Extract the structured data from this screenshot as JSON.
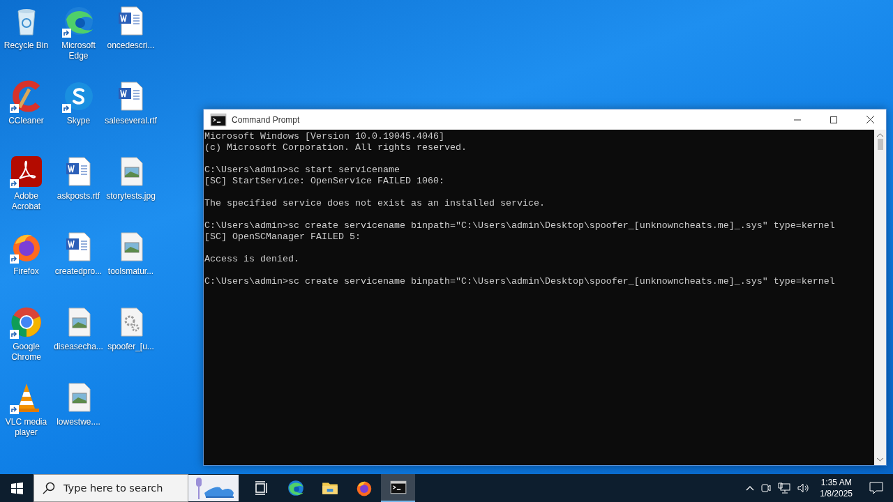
{
  "desktop_icons": [
    {
      "label": "Recycle Bin",
      "kind": "recycle",
      "shortcut": false
    },
    {
      "label": "CCleaner",
      "kind": "ccleaner",
      "shortcut": true
    },
    {
      "label": "Adobe Acrobat",
      "kind": "acrobat",
      "shortcut": true
    },
    {
      "label": "Firefox",
      "kind": "firefox",
      "shortcut": true
    },
    {
      "label": "Google Chrome",
      "kind": "chrome",
      "shortcut": true
    },
    {
      "label": "VLC media player",
      "kind": "vlc",
      "shortcut": true
    },
    {
      "label": "Microsoft Edge",
      "kind": "edge",
      "shortcut": true
    },
    {
      "label": "Skype",
      "kind": "skype",
      "shortcut": true
    },
    {
      "label": "askposts.rtf",
      "kind": "word",
      "shortcut": false
    },
    {
      "label": "createdpro...",
      "kind": "word",
      "shortcut": false
    },
    {
      "label": "diseasecha...",
      "kind": "image",
      "shortcut": false
    },
    {
      "label": "lowestwe....",
      "kind": "image",
      "shortcut": false
    },
    {
      "label": "oncedescri...",
      "kind": "word",
      "shortcut": false
    },
    {
      "label": "saleseveral.rtf",
      "kind": "word",
      "shortcut": false
    },
    {
      "label": "storytests.jpg",
      "kind": "image",
      "shortcut": false
    },
    {
      "label": "toolsmatur...",
      "kind": "image",
      "shortcut": false
    },
    {
      "label": "spoofer_[u...",
      "kind": "gears",
      "shortcut": false
    }
  ],
  "window": {
    "title": "Command Prompt",
    "lines": [
      {
        "kind": "text",
        "text": "Microsoft Windows [Version 10.0.19045.4046]"
      },
      {
        "kind": "text",
        "text": "(c) Microsoft Corporation. All rights reserved."
      },
      {
        "kind": "prompt",
        "text": "C:\\Users\\admin>sc start servicename"
      },
      {
        "kind": "text",
        "text": "[SC] StartService: OpenService FAILED 1060:"
      },
      {
        "kind": "message",
        "text": "The specified service does not exist as an installed service."
      },
      {
        "kind": "prompt",
        "text": "C:\\Users\\admin>sc create servicename binpath=\"C:\\Users\\admin\\Desktop\\spoofer_[unknowncheats.me]_.sys\" type=kernel"
      },
      {
        "kind": "text",
        "text": "[SC] OpenSCManager FAILED 5:"
      },
      {
        "kind": "message",
        "text": "Access is denied."
      },
      {
        "kind": "prompt",
        "text": "C:\\Users\\admin>sc create servicename binpath=\"C:\\Users\\admin\\Desktop\\spoofer_[unknowncheats.me]_.sys\" type=kernel"
      }
    ]
  },
  "taskbar": {
    "search": {
      "placeholder": "Type here to search"
    },
    "apps": [
      {
        "kind": "taskview",
        "active": false
      },
      {
        "kind": "edge",
        "active": false
      },
      {
        "kind": "explorer",
        "active": false
      },
      {
        "kind": "firefox",
        "active": false
      },
      {
        "kind": "cmd",
        "active": true
      }
    ],
    "time": "1:35 AM",
    "date": "1/8/2025"
  }
}
